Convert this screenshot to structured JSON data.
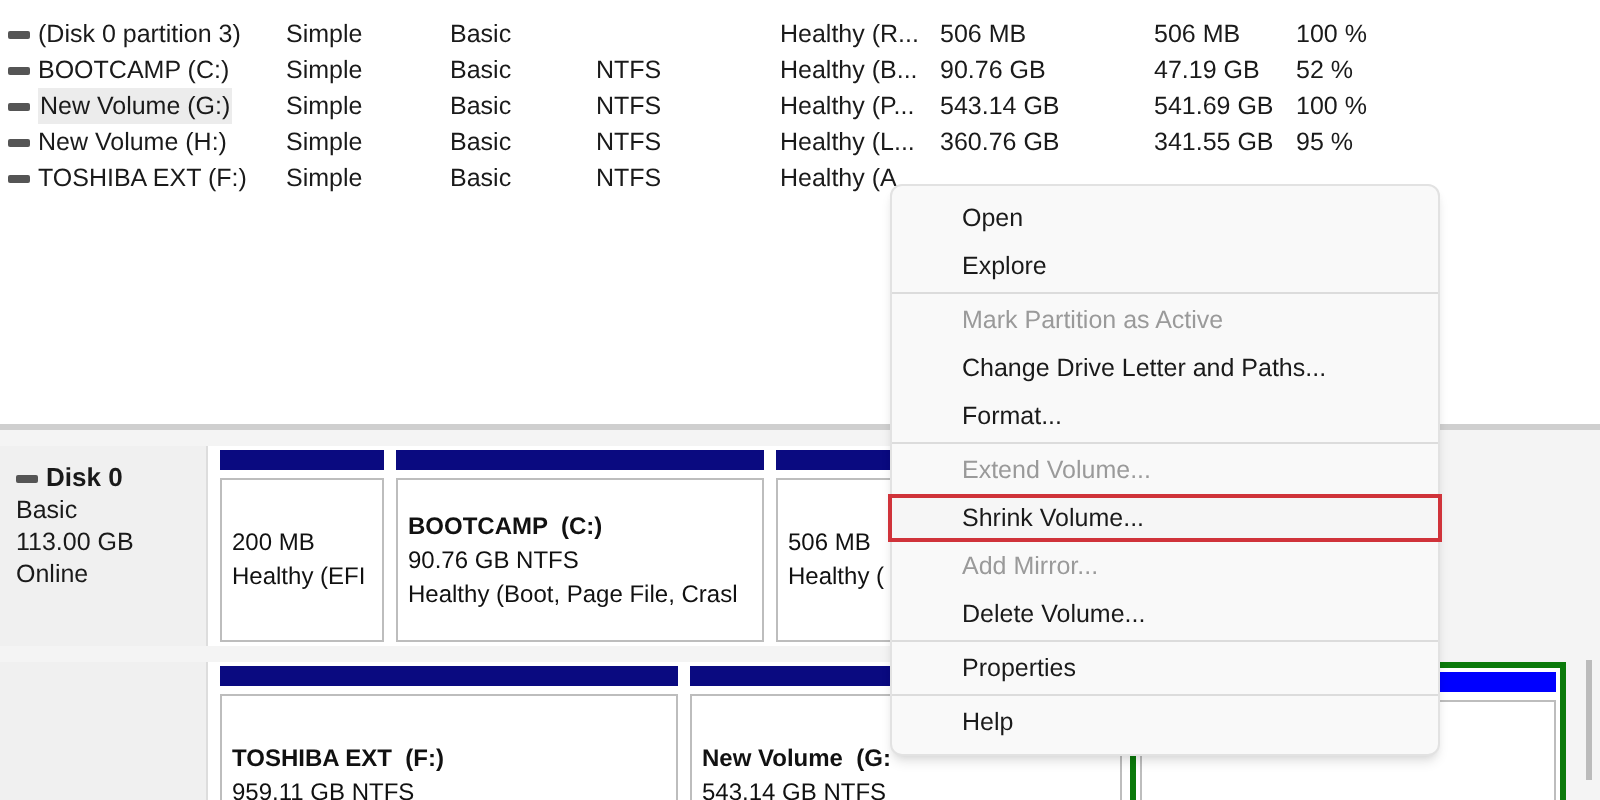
{
  "volumes": [
    {
      "name": "(Disk 0 partition 3)",
      "layout": "Simple",
      "type": "Basic",
      "status": "Healthy (R...",
      "capacity": "506 MB",
      "free_space": "506 MB",
      "percent_free": "100 %",
      "selected": false
    },
    {
      "name": "BOOTCAMP (C:)",
      "layout": "Simple",
      "type": "Basic",
      "file_system": "NTFS",
      "status": "Healthy (B...",
      "capacity": "90.76 GB",
      "free_space": "47.19 GB",
      "percent_free": "52 %",
      "selected": false
    },
    {
      "name": "New Volume (G:)",
      "layout": "Simple",
      "type": "Basic",
      "file_system": "NTFS",
      "status": "Healthy (P...",
      "capacity": "543.14 GB",
      "free_space": "541.69 GB",
      "percent_free": "100 %",
      "selected": true
    },
    {
      "name": "New Volume (H:)",
      "layout": "Simple",
      "type": "Basic",
      "file_system": "NTFS",
      "status": "Healthy (L...",
      "capacity": "360.76 GB",
      "free_space": "341.55 GB",
      "percent_free": "95 %",
      "selected": false
    },
    {
      "name": "TOSHIBA EXT (F:)",
      "layout": "Simple",
      "type": "Basic",
      "file_system": "NTFS",
      "status": "Healthy (A",
      "selected": false
    }
  ],
  "disks": [
    {
      "name": "Disk 0",
      "lines": [
        "Basic",
        "113.00 GB",
        "Online"
      ],
      "partitions": [
        {
          "lines": [
            "200 MB",
            "Healthy (EFI"
          ],
          "kind": "primary"
        },
        {
          "title": "BOOTCAMP  (C:)",
          "lines": [
            "90.76 GB NTFS",
            "Healthy (Boot, Page File, Crasl"
          ],
          "kind": "primary"
        },
        {
          "lines": [
            "506 MB",
            "Healthy ("
          ],
          "kind": "primary"
        }
      ]
    },
    {
      "partitions": [
        {
          "title": "TOSHIBA EXT  (F:)",
          "lines": [
            "959.11 GB NTFS"
          ],
          "kind": "primary"
        },
        {
          "title": "New Volume  (G:",
          "lines": [
            "543.14 GB NTFS"
          ],
          "kind": "primary"
        },
        {
          "kind": "logical"
        }
      ]
    }
  ],
  "context_menu": {
    "groups": [
      [
        {
          "label": "Open",
          "disabled": false,
          "selected": false
        },
        {
          "label": "Explore",
          "disabled": false,
          "selected": false
        }
      ],
      [
        {
          "label": "Mark Partition as Active",
          "disabled": true,
          "selected": false
        },
        {
          "label": "Change Drive Letter and Paths...",
          "disabled": false,
          "selected": false
        },
        {
          "label": "Format...",
          "disabled": false,
          "selected": false
        }
      ],
      [
        {
          "label": "Extend Volume...",
          "disabled": true,
          "selected": false
        },
        {
          "label": "Shrink Volume...",
          "disabled": false,
          "selected": true
        },
        {
          "label": "Add Mirror...",
          "disabled": true,
          "selected": false
        },
        {
          "label": "Delete Volume...",
          "disabled": false,
          "selected": false
        }
      ],
      [
        {
          "label": "Properties",
          "disabled": false,
          "selected": false
        }
      ],
      [
        {
          "label": "Help",
          "disabled": false,
          "selected": false
        }
      ]
    ]
  }
}
